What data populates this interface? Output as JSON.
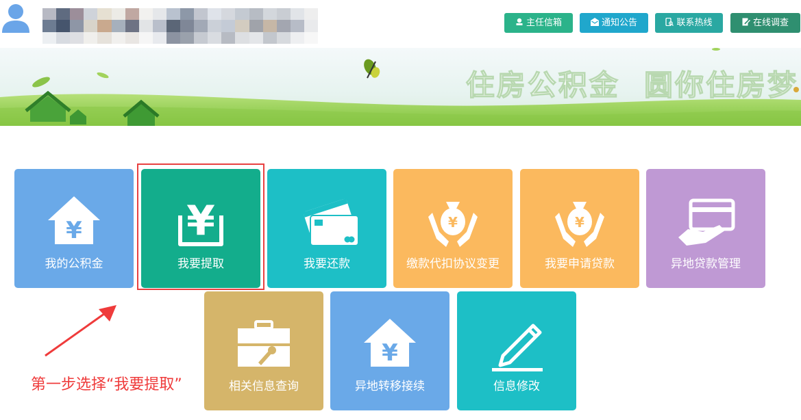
{
  "header": {
    "buttons": [
      {
        "label": "主任信箱",
        "icon": "award-icon",
        "color": "#2bb38a"
      },
      {
        "label": "通知公告",
        "icon": "envelope-icon",
        "color": "#20a7cc"
      },
      {
        "label": "联系热线",
        "icon": "phone-search-icon",
        "color": "#2aa8a2"
      },
      {
        "label": "在线调查",
        "icon": "edit-icon",
        "color": "#2f8f70"
      }
    ]
  },
  "banner": {
    "slogan": "住房公积金  圆你住房梦"
  },
  "tiles": [
    {
      "label": "我的公积金",
      "icon": "house-yen-icon",
      "color": "#6aa9e8"
    },
    {
      "label": "我要提取",
      "icon": "yen-withdraw-icon",
      "color": "#13ad8c"
    },
    {
      "label": "我要还款",
      "icon": "credit-card-icon",
      "color": "#1dbfc6"
    },
    {
      "label": "缴款代扣协议变更",
      "icon": "money-bag-hands-icon",
      "color": "#fbb95e"
    },
    {
      "label": "我要申请贷款",
      "icon": "money-bag-hands-icon",
      "color": "#fbb95e"
    },
    {
      "label": "异地贷款管理",
      "icon": "card-hand-icon",
      "color": "#bf99d4"
    },
    {
      "label": "相关信息查询",
      "icon": "toolbox-icon",
      "color": "#d5b56a"
    },
    {
      "label": "异地转移接续",
      "icon": "house-yen-icon",
      "color": "#6aa9e8"
    },
    {
      "label": "信息修改",
      "icon": "pencil-icon",
      "color": "#1dbfc6"
    }
  ],
  "annotation": {
    "text": "第一步选择“我要提取”"
  },
  "colors": {
    "highlight": "#e84040",
    "annotation": "#ef3b3b"
  }
}
